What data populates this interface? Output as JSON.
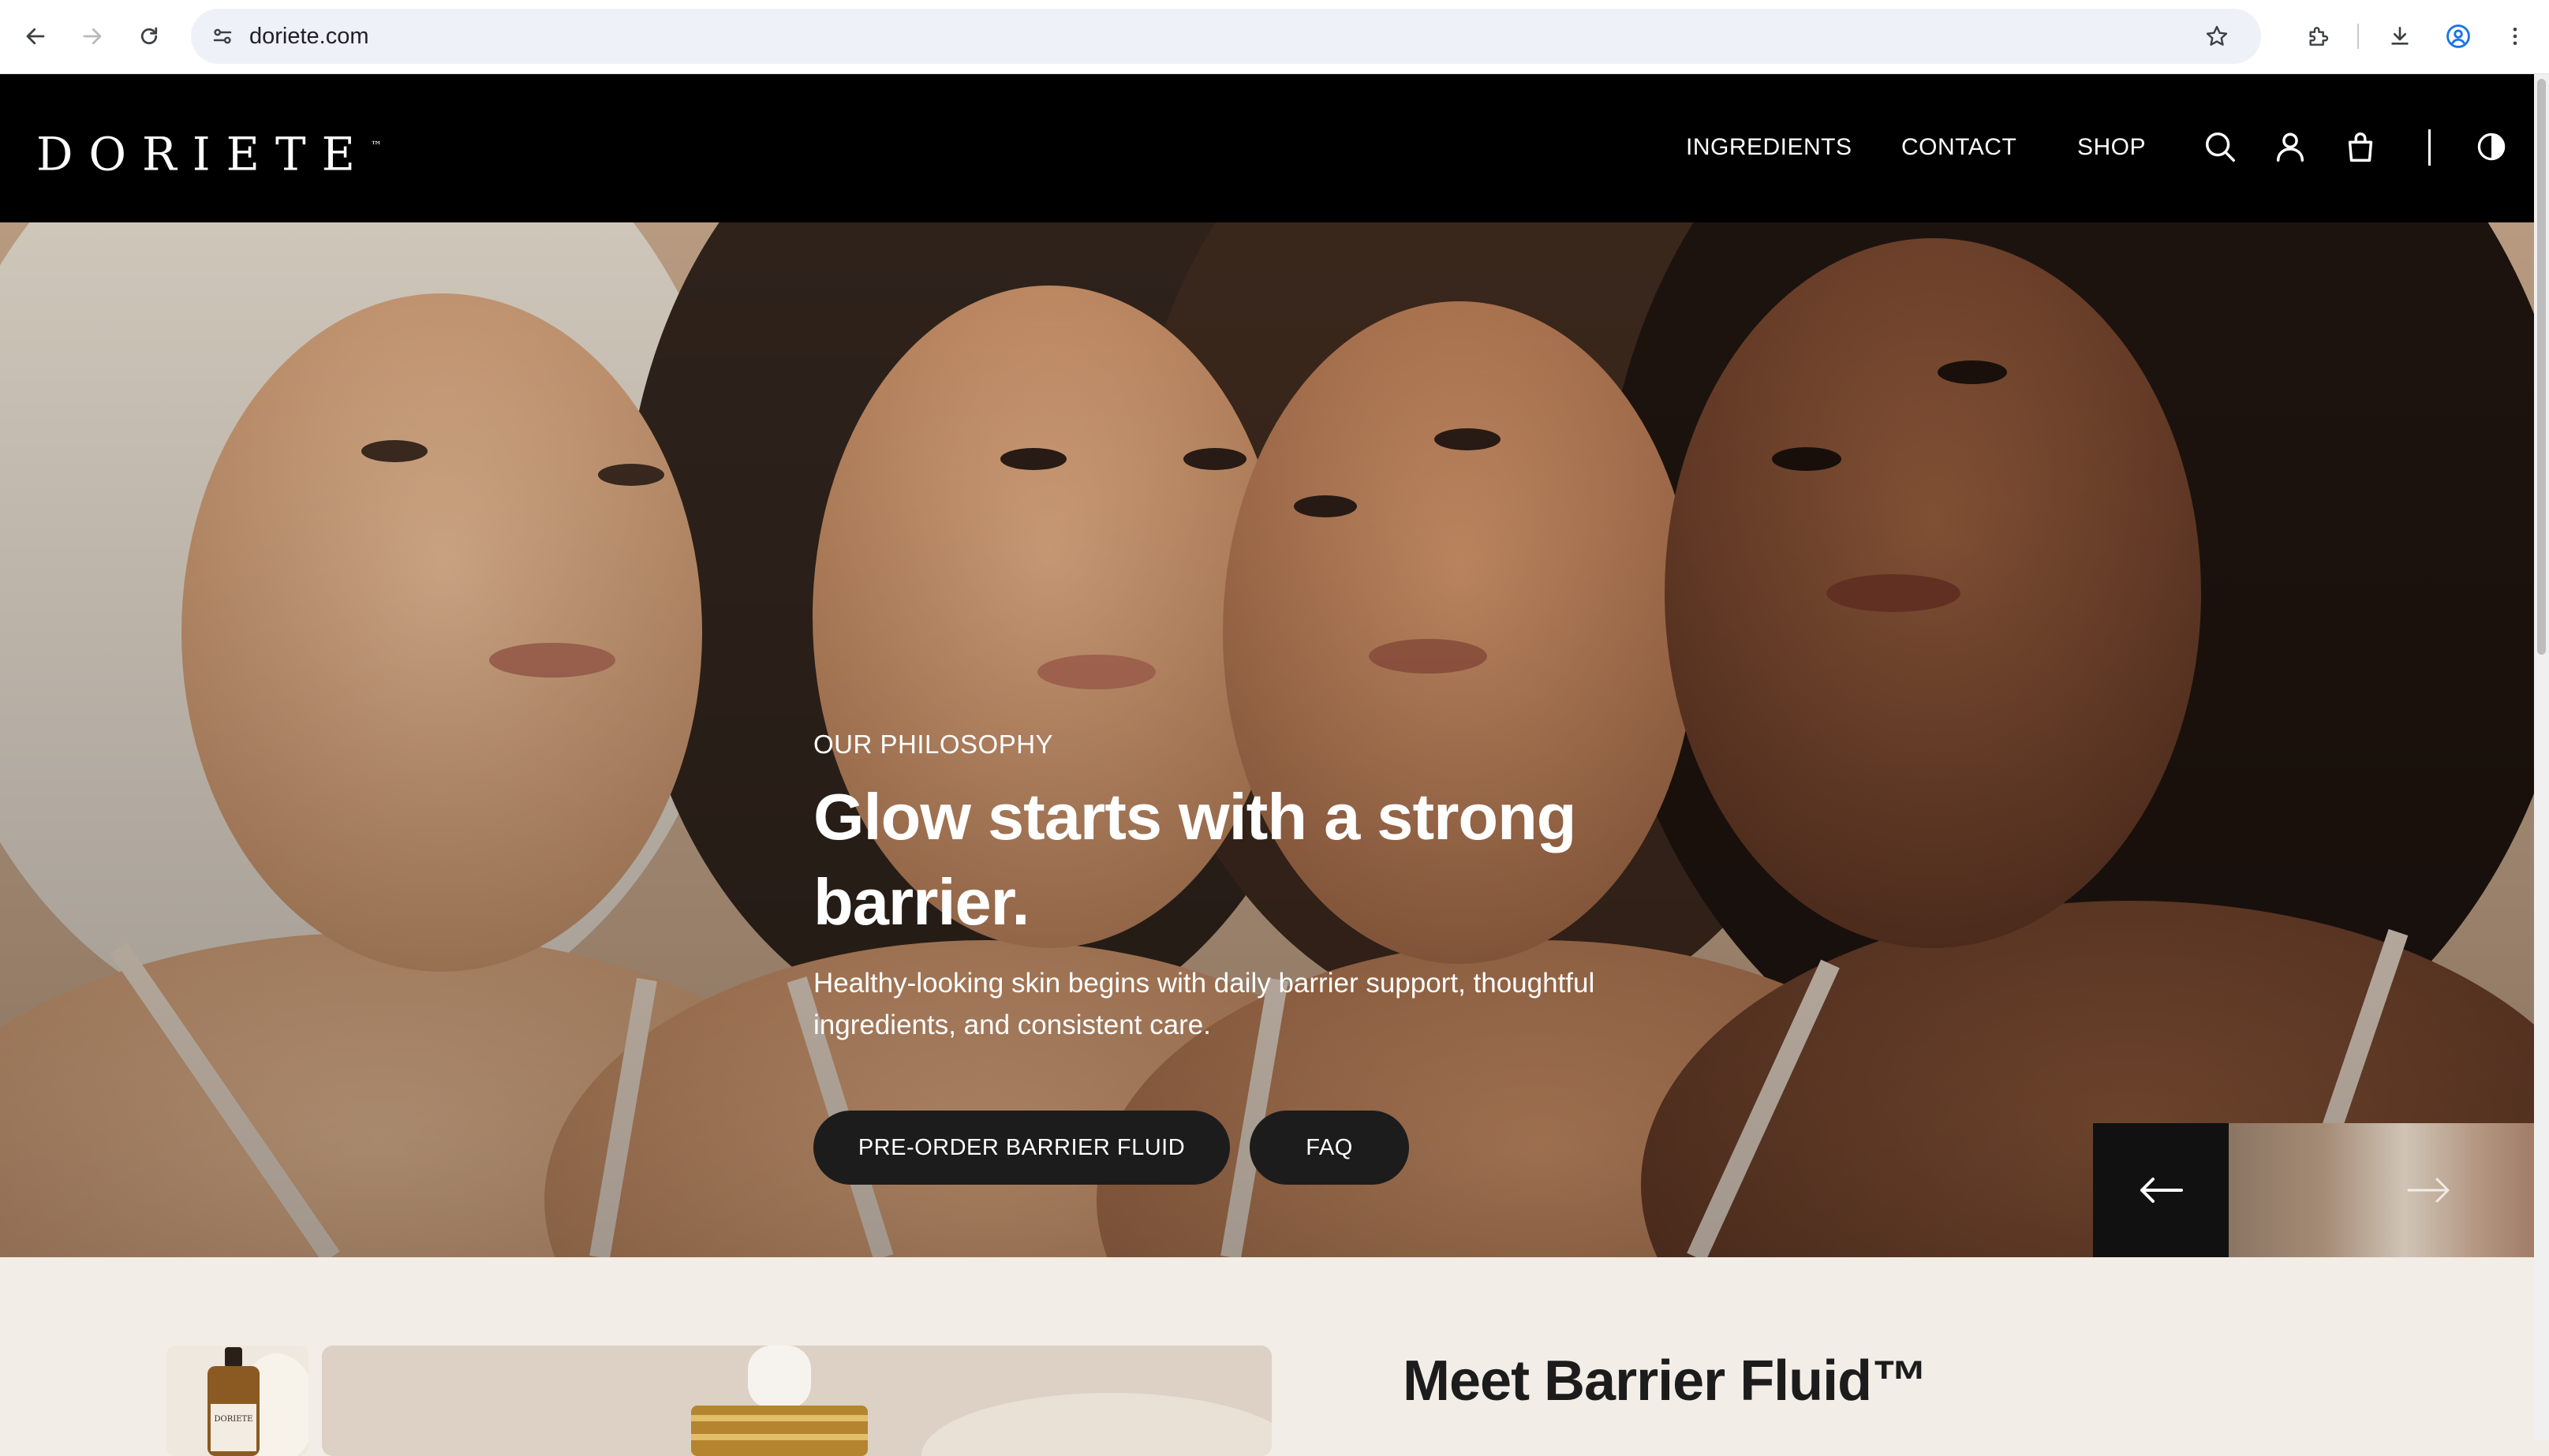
{
  "browser": {
    "url": "doriete.com",
    "icons": [
      "back-icon",
      "forward-icon",
      "reload-icon",
      "site-info-icon",
      "star-icon",
      "extensions-icon",
      "download-icon",
      "profile-icon",
      "more-menu-icon"
    ]
  },
  "site": {
    "brand": "DORIETE",
    "brand_tm": "™",
    "nav": [
      {
        "label": "INGREDIENTS"
      },
      {
        "label": "CONTACT"
      },
      {
        "label": "SHOP"
      }
    ],
    "header_icons": [
      "search-icon",
      "account-icon",
      "cart-icon",
      "theme-toggle-icon"
    ]
  },
  "hero": {
    "eyebrow": "OUR PHILOSOPHY",
    "title": "Glow starts with a strong barrier.",
    "subtitle": "Healthy-looking skin begins with daily barrier support, thoughtful ingredients, and consistent care.",
    "primary_cta": "PRE-ORDER BARRIER FLUID",
    "secondary_cta": "FAQ",
    "slider_icons": [
      "arrow-left-icon",
      "arrow-right-icon"
    ]
  },
  "product": {
    "title": "Meet Barrier Fluid™",
    "bottle_label": "DORIETE"
  },
  "colors": {
    "header_bg": "#000000",
    "button_bg": "#1c1c1c",
    "section_bg": "#f3ede7",
    "omnibox_bg": "#eef1f8",
    "profile_accent": "#1a73e8"
  }
}
